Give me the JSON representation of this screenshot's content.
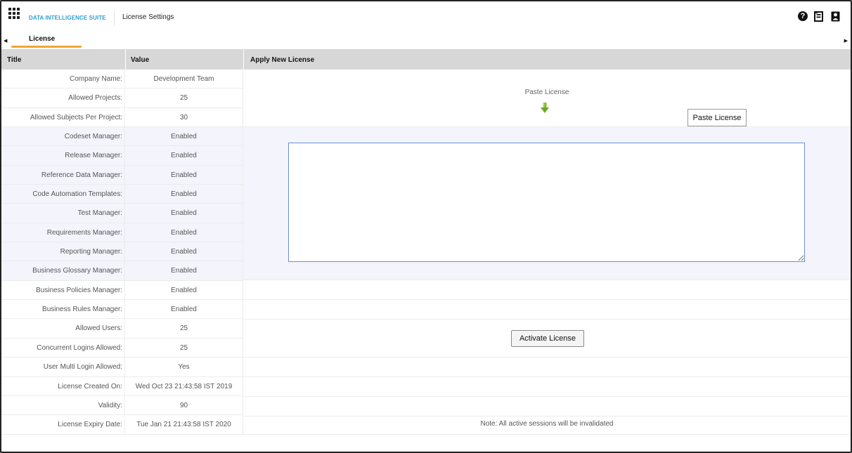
{
  "app": {
    "suite_name": "DATA INTELLIGENCE SUITE",
    "page_title": "License Settings"
  },
  "topbar_icons": [
    "help-icon",
    "document-icon",
    "user-profile-icon"
  ],
  "tabs": [
    {
      "label": "License",
      "active": true
    }
  ],
  "columns": {
    "title": "Title",
    "value": "Value",
    "apply": "Apply New License"
  },
  "rows": [
    {
      "title": "Company Name:",
      "value": "Development Team"
    },
    {
      "title": "Allowed Projects:",
      "value": "25"
    },
    {
      "title": "Allowed Subjects Per Project:",
      "value": "30"
    },
    {
      "title": "Codeset Manager:",
      "value": "Enabled"
    },
    {
      "title": "Release Manager:",
      "value": "Enabled"
    },
    {
      "title": "Reference Data Manager:",
      "value": "Enabled"
    },
    {
      "title": "Code Automation Templates:",
      "value": "Enabled"
    },
    {
      "title": "Test Manager:",
      "value": "Enabled"
    },
    {
      "title": "Requirements Manager:",
      "value": "Enabled"
    },
    {
      "title": "Reporting Manager:",
      "value": "Enabled"
    },
    {
      "title": "Business Glossary Manager:",
      "value": "Enabled"
    },
    {
      "title": "Business Policies Manager:",
      "value": "Enabled"
    },
    {
      "title": "Business Rules Manager:",
      "value": "Enabled"
    },
    {
      "title": "Allowed Users:",
      "value": "25"
    },
    {
      "title": "Concurrent Logins Allowed:",
      "value": "25"
    },
    {
      "title": "User Multi Login Allowed:",
      "value": "Yes"
    },
    {
      "title": "License Created On:",
      "value": "Wed Oct 23 21:43:58 IST 2019"
    },
    {
      "title": "Validity:",
      "value": "90"
    },
    {
      "title": "License Expiry Date:",
      "value": "Tue Jan 21 21:43:58 IST 2020"
    }
  ],
  "apply": {
    "paste_label": "Paste License",
    "paste_button": "Paste License",
    "textarea_value": "",
    "activate_button": "Activate License",
    "note": "Note: All active sessions will be invalidated"
  },
  "colors": {
    "accent": "#2f9fd0",
    "tab_underline": "#f0a534",
    "header_bg": "#d7d7d7",
    "highlight_bg": "#f4f4fc",
    "arrow": "#7bbf2a"
  }
}
